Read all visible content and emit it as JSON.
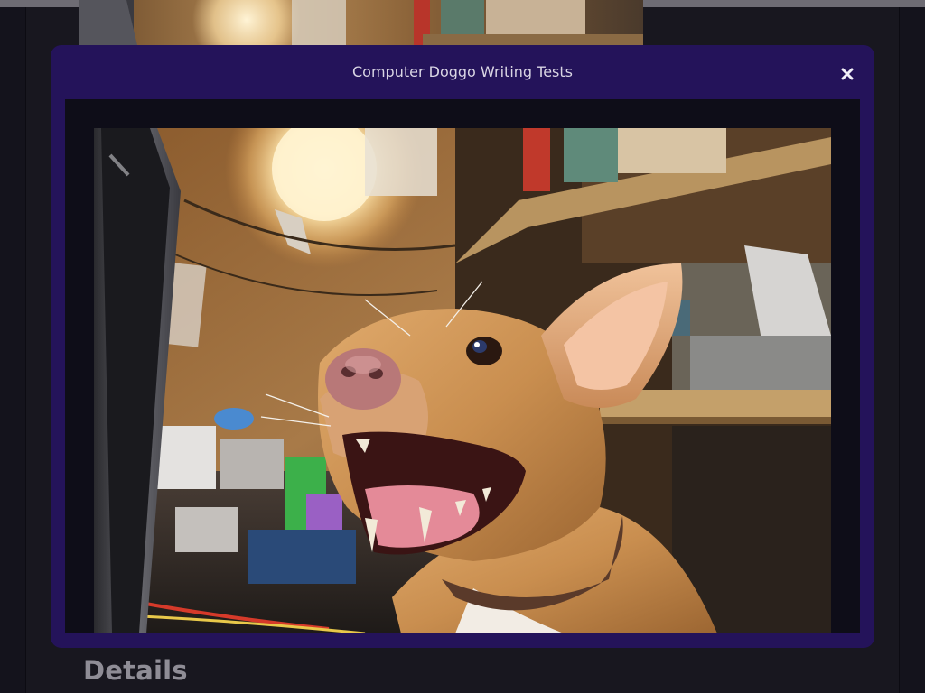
{
  "modal": {
    "title": "Computer Doggo Writing Tests",
    "close_icon": "close-icon"
  },
  "image": {
    "subject": "dog-at-computer-photo"
  },
  "page": {
    "details_heading": "Details"
  },
  "colors": {
    "modal_bg": "#24135a",
    "frame_bg": "#0e0d18",
    "page_bg": "#14131c",
    "heading": "#8f8d96"
  }
}
